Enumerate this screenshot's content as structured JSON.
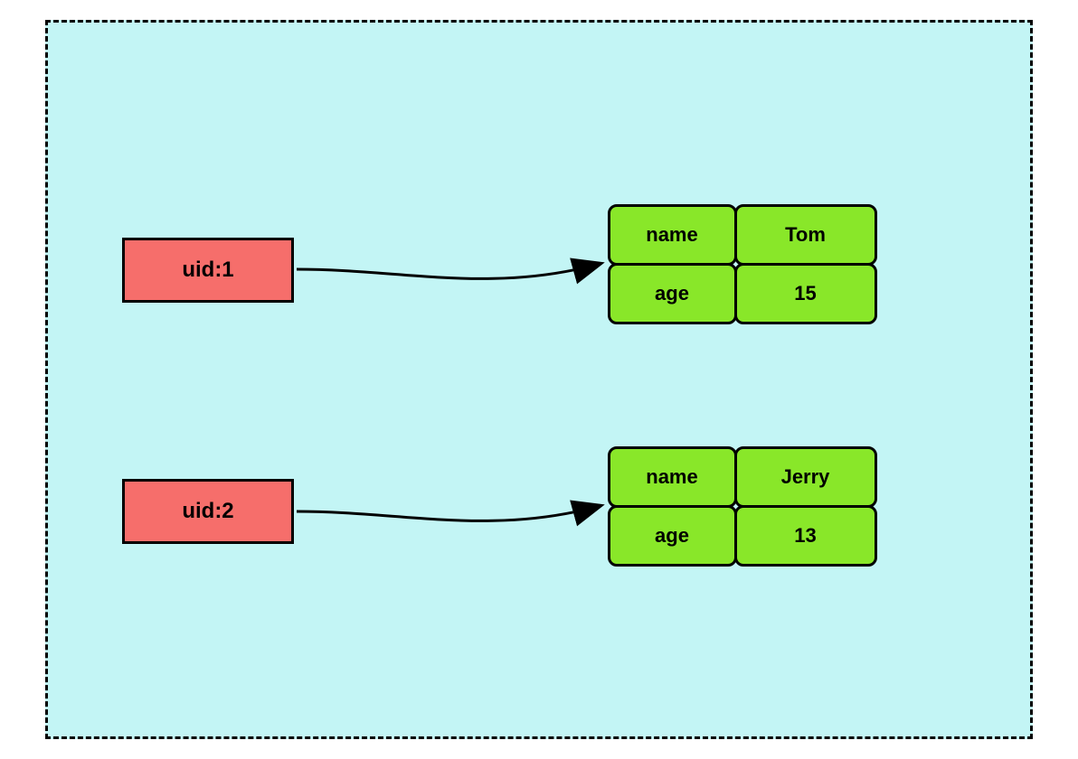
{
  "entries": [
    {
      "key": "uid:1",
      "fields": [
        {
          "label": "name",
          "value": "Tom"
        },
        {
          "label": "age",
          "value": "15"
        }
      ]
    },
    {
      "key": "uid:2",
      "fields": [
        {
          "label": "name",
          "value": "Jerry"
        },
        {
          "label": "age",
          "value": "13"
        }
      ]
    }
  ],
  "colors": {
    "container_bg": "#c3f5f5",
    "key_bg": "#f66e6b",
    "value_bg": "#89e729",
    "border": "#000000"
  }
}
